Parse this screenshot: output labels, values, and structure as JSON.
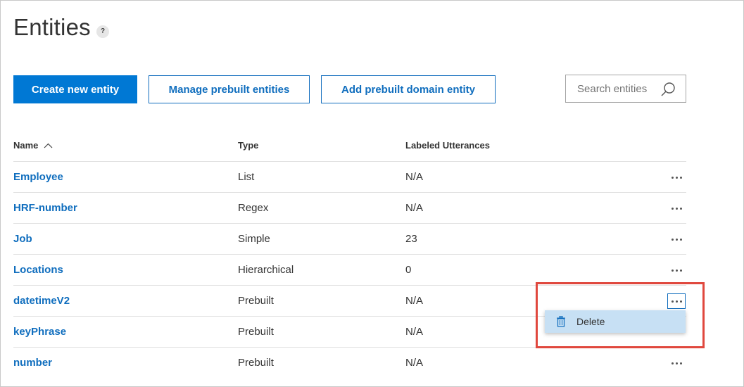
{
  "page": {
    "title": "Entities",
    "help_label": "?"
  },
  "toolbar": {
    "create_label": "Create new entity",
    "manage_label": "Manage prebuilt entities",
    "domain_label": "Add prebuilt domain entity"
  },
  "search": {
    "placeholder": "Search entities",
    "icon": "search-icon"
  },
  "table": {
    "columns": [
      "Name",
      "Type",
      "Labeled Utterances"
    ],
    "sort": {
      "column": "Name",
      "direction": "ascending"
    },
    "rows": [
      {
        "name": "Employee",
        "type": "List",
        "utterances": "N/A"
      },
      {
        "name": "HRF-number",
        "type": "Regex",
        "utterances": "N/A"
      },
      {
        "name": "Job",
        "type": "Simple",
        "utterances": "23"
      },
      {
        "name": "Locations",
        "type": "Hierarchical",
        "utterances": "0"
      },
      {
        "name": "datetimeV2",
        "type": "Prebuilt",
        "utterances": "N/A"
      },
      {
        "name": "keyPhrase",
        "type": "Prebuilt",
        "utterances": "N/A"
      },
      {
        "name": "number",
        "type": "Prebuilt",
        "utterances": "N/A"
      }
    ]
  },
  "context_menu": {
    "open_for_row": "datetimeV2",
    "items": [
      {
        "label": "Delete",
        "icon": "trash-icon"
      }
    ]
  },
  "colors": {
    "accent": "#0078d4",
    "link": "#106ebe",
    "menu_highlight": "#c7e0f4",
    "annotation": "#e0483e"
  }
}
